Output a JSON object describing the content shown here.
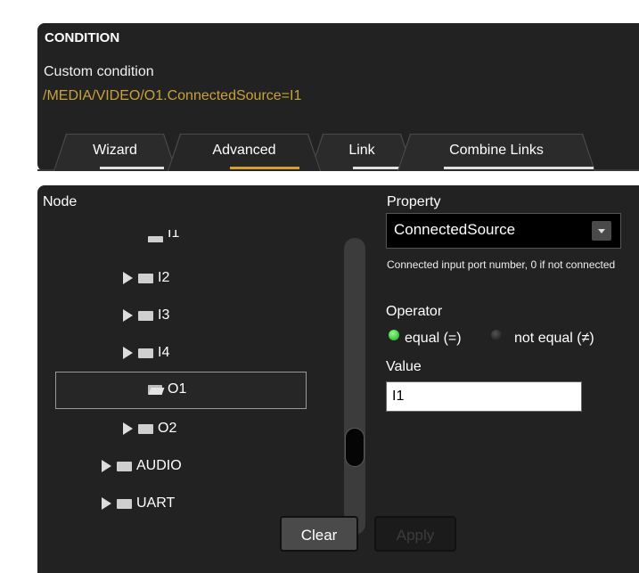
{
  "condition": {
    "title": "CONDITION",
    "subtitle": "Custom condition",
    "expression": "/MEDIA/VIDEO/O1.ConnectedSource=I1"
  },
  "tabs": [
    {
      "label": "Wizard",
      "active": false
    },
    {
      "label": "Advanced",
      "active": true
    },
    {
      "label": "Link",
      "active": false
    },
    {
      "label": "Combine Links",
      "active": false
    }
  ],
  "node": {
    "label": "Node",
    "items": [
      {
        "label": "I1",
        "icon": "folder-icon"
      },
      {
        "label": "I2",
        "icon": "folder-icon"
      },
      {
        "label": "I3",
        "icon": "folder-icon"
      },
      {
        "label": "I4",
        "icon": "folder-icon"
      },
      {
        "label": "O1",
        "icon": "folder-open-icon",
        "selected": true
      },
      {
        "label": "O2",
        "icon": "folder-icon"
      },
      {
        "label": "AUDIO",
        "icon": "folder-icon"
      },
      {
        "label": "UART",
        "icon": "folder-icon"
      }
    ]
  },
  "property": {
    "label": "Property",
    "selected": "ConnectedSource",
    "description": "Connected input port number, 0 if not connected"
  },
  "operator": {
    "label": "Operator",
    "options": [
      {
        "label": "equal (=)",
        "checked": true
      },
      {
        "label": "not equal (≠)",
        "checked": false
      }
    ]
  },
  "value": {
    "label": "Value",
    "current": "I1"
  },
  "buttons": {
    "clear": "Clear",
    "apply": "Apply"
  },
  "colors": {
    "accent": "#d4a02a",
    "expression": "#c8a23a",
    "panel": "#222222",
    "radio_on": "#1aa31a"
  }
}
